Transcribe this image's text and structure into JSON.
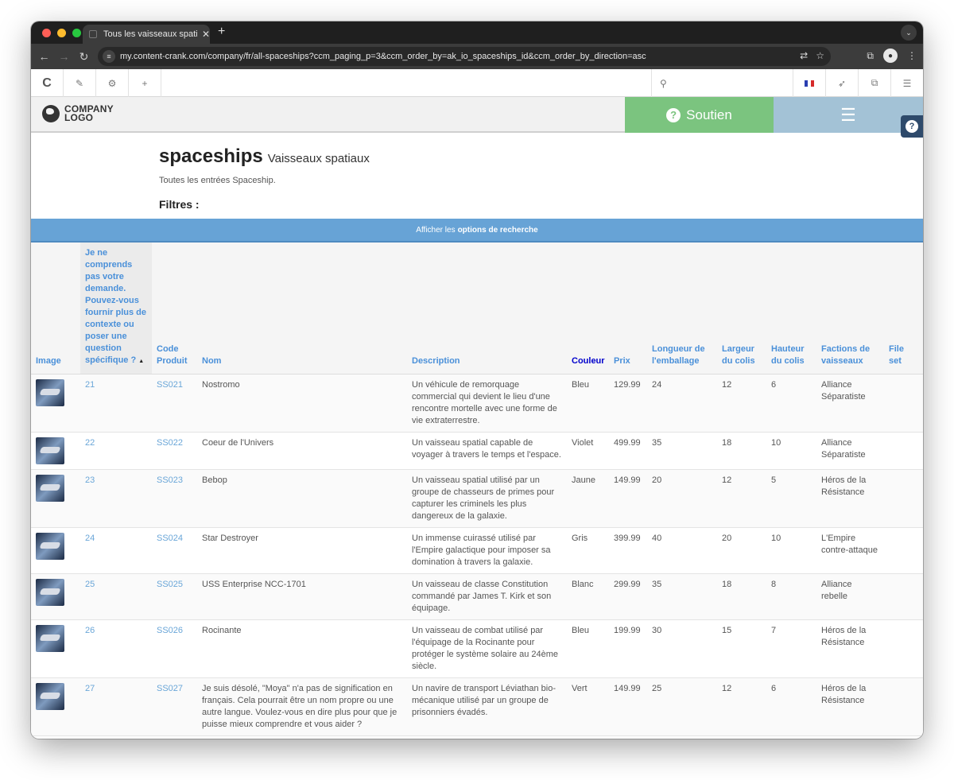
{
  "browser": {
    "tab_title": "Tous les vaisseaux spatiaux : ",
    "url": "my.content-crank.com/company/fr/all-spaceships?ccm_paging_p=3&ccm_order_by=ak_io_spaceships_id&ccm_order_by_direction=asc"
  },
  "site": {
    "logo_line1": "COMPANY",
    "logo_line2": "LOGO",
    "support_label": "Soutien"
  },
  "page": {
    "title": "spaceships",
    "subtitle": "Vaisseaux spatiaux",
    "description": "Toutes les entrées Spaceship.",
    "filters_label": "Filtres :",
    "search_prefix": "Afficher les",
    "search_bold": "options de recherche"
  },
  "table": {
    "headers": {
      "image": "Image",
      "id": "Je ne comprends pas votre demande. Pouvez-vous fournir plus de contexte ou poser une question spécifique ?",
      "code": "Code Produit",
      "name": "Nom",
      "description": "Description",
      "color": "Couleur",
      "price": "Prix",
      "length": "Longueur de l'emballage",
      "width": "Largeur du colis",
      "height": "Hauteur du colis",
      "factions": "Factions de vaisseaux",
      "fileset": "File set"
    },
    "rows": [
      {
        "id": "21",
        "code": "SS021",
        "name": "Nostromo",
        "description": "Un véhicule de remorquage commercial qui devient le lieu d'une rencontre mortelle avec une forme de vie extraterrestre.",
        "color": "Bleu",
        "price": "129.99",
        "length": "24",
        "width": "12",
        "height": "6",
        "faction": "Alliance Séparatiste"
      },
      {
        "id": "22",
        "code": "SS022",
        "name": "Coeur de l'Univers",
        "description": "Un vaisseau spatial capable de voyager à travers le temps et l'espace.",
        "color": "Violet",
        "price": "499.99",
        "length": "35",
        "width": "18",
        "height": "10",
        "faction": "Alliance Séparatiste"
      },
      {
        "id": "23",
        "code": "SS023",
        "name": "Bebop",
        "description": "Un vaisseau spatial utilisé par un groupe de chasseurs de primes pour capturer les criminels les plus dangereux de la galaxie.",
        "color": "Jaune",
        "price": "149.99",
        "length": "20",
        "width": "12",
        "height": "5",
        "faction": "Héros de la Résistance"
      },
      {
        "id": "24",
        "code": "SS024",
        "name": "Star Destroyer",
        "description": "Un immense cuirassé utilisé par l'Empire galactique pour imposer sa domination à travers la galaxie.",
        "color": "Gris",
        "price": "399.99",
        "length": "40",
        "width": "20",
        "height": "10",
        "faction": "L'Empire contre-attaque"
      },
      {
        "id": "25",
        "code": "SS025",
        "name": "USS Enterprise NCC-1701",
        "description": "Un vaisseau de classe Constitution commandé par James T. Kirk et son équipage.",
        "color": "Blanc",
        "price": "299.99",
        "length": "35",
        "width": "18",
        "height": "8",
        "faction": "Alliance rebelle"
      },
      {
        "id": "26",
        "code": "SS026",
        "name": "Rocinante",
        "description": "Un vaisseau de combat utilisé par l'équipage de la Rocinante pour protéger le système solaire au 24ème siècle.",
        "color": "Bleu",
        "price": "199.99",
        "length": "30",
        "width": "15",
        "height": "7",
        "faction": "Héros de la Résistance"
      },
      {
        "id": "27",
        "code": "SS027",
        "name": "Je suis désolé, \"Moya\" n'a pas de signification en français. Cela pourrait être un nom propre ou une autre langue. Voulez-vous en dire plus pour que je puisse mieux comprendre et vous aider ?",
        "description": "Un navire de transport Léviathan bio-mécanique utilisé par un groupe de prisonniers évadés.",
        "color": "Vert",
        "price": "149.99",
        "length": "25",
        "width": "12",
        "height": "6",
        "faction": "Héros de la Résistance"
      }
    ]
  },
  "colors": {
    "support": "#7bc47f",
    "menu": "#a3c2d6",
    "search_bar": "#67a3d6",
    "link": "#6aa6d8"
  }
}
